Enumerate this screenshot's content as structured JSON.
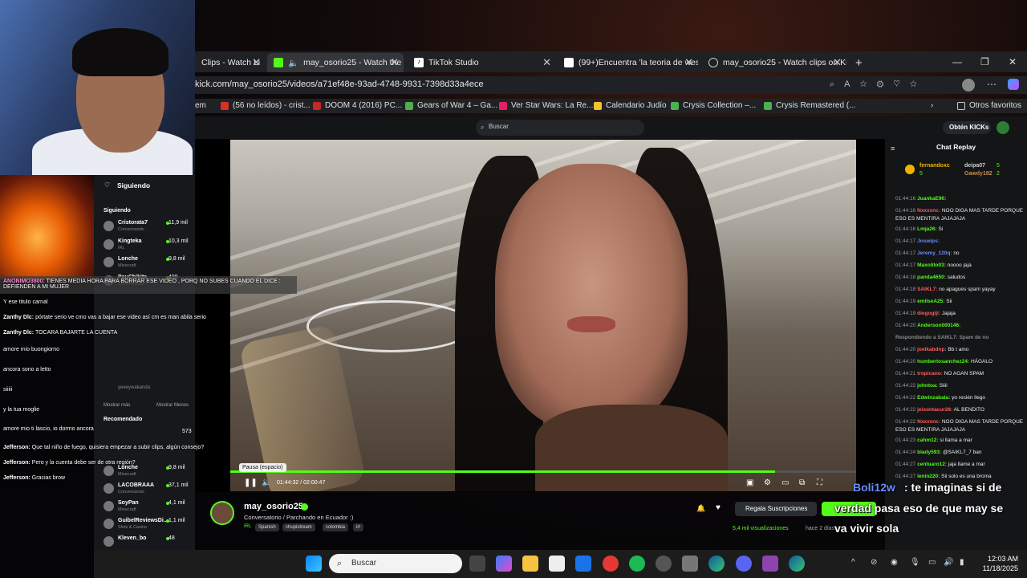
{
  "browser": {
    "tabs": [
      {
        "label": "Clips - Watch Li",
        "icon": "kick-icon"
      },
      {
        "label": "may_osorio25 - Watch the V",
        "icon": "kick-icon"
      },
      {
        "label": "TikTok Studio",
        "icon": "tiktok-icon"
      },
      {
        "label": "(99+)Encuentra 'la teoria de west",
        "icon": "tiktok-icon"
      },
      {
        "label": "may_osorio25 - Watch clips on Ki",
        "icon": "globe-icon"
      }
    ],
    "url": "kick.com/may_osorio25/videos/a71ef48e-93ad-4748-9931-7398d33a4ece",
    "bookmarks": [
      "(56 no leídos) - crist...",
      "DOOM 4 (2016) PC...",
      "Gears of War 4 – Ga...",
      "Ver Star Wars: La Re...",
      "Calendario Judío",
      "Crysis Collection –...",
      "Crysis Remastered (..."
    ],
    "bookmarks_first": "em",
    "other_favorites": "Otros favoritos"
  },
  "kick": {
    "search_placeholder": "Buscar",
    "kicks_button": "Obtén KICKs",
    "player": {
      "tooltip": "Pausa (espacio)",
      "time": "01:44:32 / 02:00:47",
      "progress": 0.87
    },
    "channel": {
      "name": "may_osorio25",
      "title": "Conversatorio / Parchando en Ecuador :)",
      "category": "IRL",
      "tags": [
        "Spanish",
        "chupistream",
        "colombia",
        "irl"
      ],
      "subscribe": "Regala Suscripciones",
      "views": "5,4 mil visualizaciones",
      "ago": "hace 2 días"
    },
    "chat": {
      "header": "Chat Replay",
      "top": [
        {
          "name": "fernandoxc",
          "n": "5"
        },
        {
          "name": "deipa07",
          "n": "5"
        },
        {
          "name": "Gawdy182",
          "n": "2"
        }
      ],
      "lines": [
        {
          "t": "01:44:16",
          "u": "JuankaE90:",
          "m": "",
          "c": "#53fc18"
        },
        {
          "t": "01:44:16",
          "u": "Nxxxxnc:",
          "m": "NOO DIGA MAS TARDE PORQUE ESO ES MENTIRA JAJAJAJA",
          "c": "#ff5c5c"
        },
        {
          "t": "01:44:16",
          "u": "Lmja26:",
          "m": "Si",
          "c": "#53fc18"
        },
        {
          "t": "01:44:17",
          "u": "Joswips:",
          "m": "",
          "c": "#6a8cff"
        },
        {
          "t": "01:44:17",
          "u": "Jeremy_120q:",
          "m": "no",
          "c": "#6a8cff"
        },
        {
          "t": "01:44:17",
          "u": "Maxolito03:",
          "m": "noooo jaja",
          "c": "#53fc18"
        },
        {
          "t": "01:44:18",
          "u": "panda4650:",
          "m": "saludos",
          "c": "#53fc18"
        },
        {
          "t": "01:44:18",
          "u": "SAIKL7:",
          "m": "no apagues spam yayay",
          "c": "#ff5c5c"
        },
        {
          "t": "01:44:19",
          "u": "emilseA25:",
          "m": "Sii",
          "c": "#53fc18"
        },
        {
          "t": "01:44:19",
          "u": "diegogiji:",
          "m": "Jajaja",
          "c": "#ff5c5c"
        },
        {
          "t": "01:44:20",
          "u": "Anderson000146:",
          "m": "",
          "c": "#53fc18"
        },
        {
          "t": "",
          "u": "Respondiendo a SAIKL7: Spam de no",
          "m": "",
          "c": "#888"
        },
        {
          "t": "01:44:20",
          "u": "joelkabdnp:",
          "m": "Bb t amo",
          "c": "#ff5c5c"
        },
        {
          "t": "01:44:20",
          "u": "humbertosanchez24:",
          "m": "HÁGALO",
          "c": "#53fc18"
        },
        {
          "t": "01:44:21",
          "u": "tropicano:",
          "m": "NO AGAN SPAM",
          "c": "#ff5c5c"
        },
        {
          "t": "01:44:22",
          "u": "johntoa:",
          "m": "Siiii",
          "c": "#53fc18"
        },
        {
          "t": "01:44:22",
          "u": "Edwinzabala:",
          "m": "yo recién llego",
          "c": "#53fc18"
        },
        {
          "t": "01:44:22",
          "u": "jeisontacur28:",
          "m": "AL BENDITO",
          "c": "#ff5c5c"
        },
        {
          "t": "01:44:22",
          "u": "Nxxxxnc:",
          "m": "NOO DIGA MAS TARDE PORQUE ESO ES MENTIRA JAJAJAJA",
          "c": "#ff5c5c"
        },
        {
          "t": "01:44:23",
          "u": "cahm12:",
          "m": "si llama a mar",
          "c": "#53fc18"
        },
        {
          "t": "01:44:24",
          "u": "blady593:",
          "m": "@SAIKL7_7 ban",
          "c": "#53fc18"
        },
        {
          "t": "01:44:27",
          "u": "centuaro12:",
          "m": "jaja llame a mar",
          "c": "#53fc18"
        },
        {
          "t": "01:44:27",
          "u": "lenin220:",
          "m": "Sii solo es una broma",
          "c": "#53fc18"
        }
      ]
    },
    "sidebar": {
      "header": "Siguiendo",
      "section": "Siguiendo",
      "channels": [
        {
          "name": "Cristorata7",
          "sub": "Conversando",
          "v": "11,9 mil"
        },
        {
          "name": "Kingteka",
          "sub": "IRL",
          "v": "10,3 mil"
        },
        {
          "name": "Lonche",
          "sub": "Minecraft",
          "v": "9,8 mil"
        },
        {
          "name": "PauChikita",
          "sub": "Conversando",
          "v": "499"
        }
      ],
      "bottom": [
        {
          "name": "Lonche",
          "sub": "Minecraft",
          "v": "9,8 mil"
        },
        {
          "name": "LACOBRAAA",
          "sub": "Conversando",
          "v": "37,1 mil"
        },
        {
          "name": "SoyPan",
          "sub": "Minecraft",
          "v": "4,1 mil"
        },
        {
          "name": "GuibelReviewsDi...",
          "sub": "Slots & Casino",
          "v": "1,1 mil"
        },
        {
          "name": "Kleven_bo",
          "sub": "",
          "v": "48"
        }
      ],
      "mas": "Mostrar más",
      "menos": "Mostrar Menos",
      "recom": "Recomendado",
      "yeeey": "yeeeywakanda",
      "count573": "573"
    }
  },
  "overlay_chat": [
    {
      "u": "ANONIMO3800:",
      "m": "TIENES MEDIA HORA PARA BORRAR ESE VIDEO , PORQ NO SUBES CUANDO EL DICE : DEFIENDEN A MI MUJER",
      "c": "#ff8ad8"
    },
    {
      "u": "",
      "m": "Y ese titulo carnal",
      "c": "#fff"
    },
    {
      "u": "Zanthy Dlc:",
      "m": "pórtate serio ve cmo vas a bajar ese video así cm es man abila serio",
      "c": "#fff"
    },
    {
      "u": "Zanthy Dlc:",
      "m": "TOCARA BAJARTE LA CUENTA",
      "c": "#fff"
    },
    {
      "u": "",
      "m": "amore mio buongiorno",
      "c": "#fff"
    },
    {
      "u": "",
      "m": "ancora sono a letto",
      "c": "#fff"
    },
    {
      "u": "",
      "m": "siiiii",
      "c": "#fff"
    },
    {
      "u": "",
      "m": "y la tua moglie",
      "c": "#fff"
    },
    {
      "u": "",
      "m": "amore mio ti lascio, io dormo ancora",
      "c": "#fff"
    },
    {
      "u": "Jefferson:",
      "m": "Que tal niño de fuego, quisiera empezar a subir clips, algún consejo?",
      "c": "#fff"
    },
    {
      "u": "Jefferson:",
      "m": "Pero y la cuenta debe ser de otra región?",
      "c": "#fff"
    },
    {
      "u": "Jefferson:",
      "m": "Gracias brow",
      "c": "#fff"
    }
  ],
  "subtitles": {
    "line1_user": "Boli12w",
    "line1": ": te imaginas si de",
    "line2": "verdad pasa eso de que may se",
    "line3": "va vivir sola"
  },
  "taskbar": {
    "search": "Buscar",
    "time": "12:03 AM",
    "date": "11/18/2025"
  },
  "colors": {
    "kick_green": "#53fc18",
    "taskbar": "#1c1c1c"
  }
}
